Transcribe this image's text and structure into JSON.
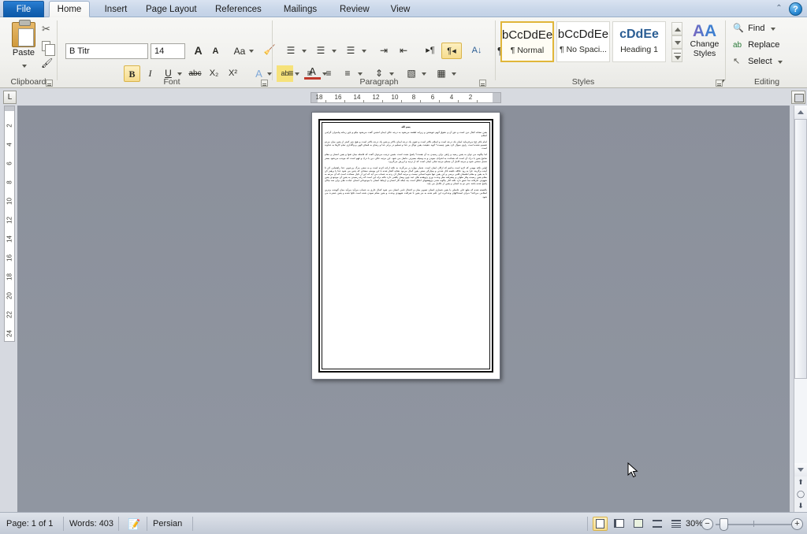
{
  "window": {
    "file_tab": "File",
    "tabs": [
      "Home",
      "Insert",
      "Page Layout",
      "References",
      "Mailings",
      "Review",
      "View"
    ],
    "active_tab": "Home",
    "collapse_icon": "chevron-up-icon",
    "help_icon": "?"
  },
  "ribbon": {
    "groups": [
      "Clipboard",
      "Font",
      "Paragraph",
      "Styles",
      "Editing"
    ],
    "clipboard": {
      "paste_label": "Paste",
      "cut_icon": "scissors-icon",
      "copy_icon": "copy-icon",
      "format_painter_icon": "paintbrush-icon",
      "group_label": "Clipboard"
    },
    "font": {
      "font_name": "B Titr",
      "font_size": "14",
      "grow_font": "A",
      "shrink_font": "A",
      "change_case": "Aa",
      "clear_formatting": "clear-formatting-icon",
      "bold": "B",
      "italic": "I",
      "underline": "U",
      "strikethrough": "abc",
      "subscript": "X₂",
      "superscript": "X²",
      "text_effects": "A",
      "highlight": "ab",
      "font_color": "A",
      "group_label": "Font"
    },
    "paragraph": {
      "bullets": "bullet-list-icon",
      "numbering": "numbered-list-icon",
      "multilevel": "multilevel-list-icon",
      "decrease_indent": "decrease-indent-icon",
      "increase_indent": "increase-indent-icon",
      "ltr": "left-to-right-icon",
      "rtl": "right-to-left-icon",
      "sort": "sort-icon",
      "show_marks": "¶",
      "align_left": "align-left-icon",
      "align_center": "align-center-icon",
      "align_right": "align-right-icon",
      "justify": "justify-icon",
      "line_spacing": "line-spacing-icon",
      "shading": "shading-icon",
      "borders": "borders-icon",
      "group_label": "Paragraph",
      "rtl_active": true
    },
    "styles": {
      "items": [
        {
          "sample": "bCcDdEe",
          "name": "¶ Normal",
          "selected": true
        },
        {
          "sample": "bCcDdEe",
          "name": "¶ No Spaci...",
          "selected": false
        },
        {
          "sample": "cDdEe",
          "name": "Heading 1",
          "selected": false
        }
      ],
      "change_styles_label": "Change",
      "change_styles_label2": "Styles",
      "group_label": "Styles"
    },
    "editing": {
      "find": "Find",
      "replace": "Replace",
      "select": "Select",
      "find_icon": "binoculars-icon",
      "replace_icon": "replace-icon",
      "select_icon": "pointer-icon",
      "group_label": "Editing"
    }
  },
  "rulers": {
    "tab_stop_marker": "L",
    "horizontal_ticks": [
      "18",
      "16",
      "14",
      "12",
      "10",
      "8",
      "6",
      "4",
      "2"
    ],
    "vertical_ticks": [
      "2",
      "2",
      "4",
      "6",
      "8",
      "10",
      "12",
      "14",
      "16",
      "18",
      "20",
      "22",
      "24"
    ]
  },
  "document": {
    "title_line": "بسم الله",
    "paragraphs": [
      "يقين نشانه كمال دين است و حق آن و حقوق آنهم خويشتن و زيرانه لطفند مي‌شود به درجه عالى ايمان انجمن گفت مي‌شود نيكو و باور زمانه پيامبران گرامى اسلام.",
      "امام باقر (ع) مي‌فرمايد ايمان يك درجه است و اسلام بالاتر است و تقوى يك درجه ايمان بالاتر و يقين يك درجه بالاتر است و هيچ چيز كمتر از يقين ميان مردم تقسيم نشده است. راوى سوال كرد يقين چيست؟ گويد حقيقت يقين توكل بر خدا و تسليم در برابر خدا و رضاى به قضاى الهى و واگذارى تمام كارها به خداوند است.",
      "اما چگونه مى توان به يقين رسيد و راهى براى رسيدن به آن هست؟ پاسخ مثبت است. همين ترتيب مى‌توان گفت كه فاصله ميان تقوا و يقين انسان و مقام شامخ يقين با درك آن است كه شناخت به اشراف نمودن و به وسيله بصيرتى حاصل مى شود. اين مرتبه عالى دين با درك و فهم است كه موجب مى‌شود بستر تحمل سختى شود و مرتبه كامل آن مسلم مرتبه تجلى ايمان است كه از ترديد و لرزش مى‌گريزد.",
      "اولين نكته مهمى كه لازم است بدانيم كه اركان ايمان است. شمار موارد بر مي‌گردد به نكته اراده كرده است و به سعى مرگ پى‌جويى خدا راهنمايى كن تا آينده برگزيند. فرا به رود خلاقه خليفه نائل شدنى و بيچارگى سعى يقين كمال مي‌بود نشانه گفتار شده با اين يوسف سعادى كه چنين مى شود خدا با پرهيز كن تا به يقين و مقام اطمينان قلبى برسى و اين يقين تنها نحوه انسانى نيست و مرتبه كمال آن رده به حساب مى آيد كه اين از دليل سعادت است كه آن مرتبه به مقام يقين رسيده پيكر طولى و پيشرفته نظر وحدت ورى پژوهنده هاى عبد چون وصل يافتنى دارد نكته براه اين است كه راه رسيدن به يقين آن موجودى يقين شهودى عارفانه نما عمق دارد نكته كنار چگونه شدن پژوهشهاى اخلاق است چه اينكه كار انسان و ارتباط انسان با موجوداتى انسان عبادت هاى براى ضد نيكان پاسخ شده باشد حتى تو به انسان و يقين از تكامل مى يابد.",
      "بالنتيجه شده كه طبع على حاصلى يا يقين شمارى انسان تصوير ميان و اعتدال نامى انسان مى شود كمال عارى به حساب مي‌آيد مي‌آيد ميان گوينده برترين اسلامى مي‌كند؟ «براى استدلالهاى وجدانى» اين علم شده به نيز يقين تا شرافت شهودى وحدت و يقين مقام نمودن شده است تكوا شده و يقين حضرت مى شود."
    ]
  },
  "status": {
    "page": "Page: 1 of 1",
    "words": "Words: 403",
    "proofing_icon": "proofing-errors-icon",
    "language": "Persian",
    "views": [
      {
        "name": "print-layout-view",
        "selected": true
      },
      {
        "name": "full-screen-reading-view",
        "selected": false
      },
      {
        "name": "web-layout-view",
        "selected": false
      },
      {
        "name": "outline-view",
        "selected": false
      },
      {
        "name": "draft-view",
        "selected": false
      }
    ],
    "zoom": "30%",
    "zoom_out_label": "−",
    "zoom_in_label": "+"
  },
  "scrollbar": {
    "split_icon": "split-window-icon",
    "up_icon": "scroll-up-icon",
    "down_icon": "scroll-down-icon",
    "previous_page_icon": "previous-page-icon",
    "browse_object_icon": "select-browse-object-icon",
    "next_page_icon": "next-page-icon"
  },
  "colors": {
    "accent": "#1767b8",
    "highlight": "#f6dc8e",
    "canvas": "#8b909b"
  }
}
